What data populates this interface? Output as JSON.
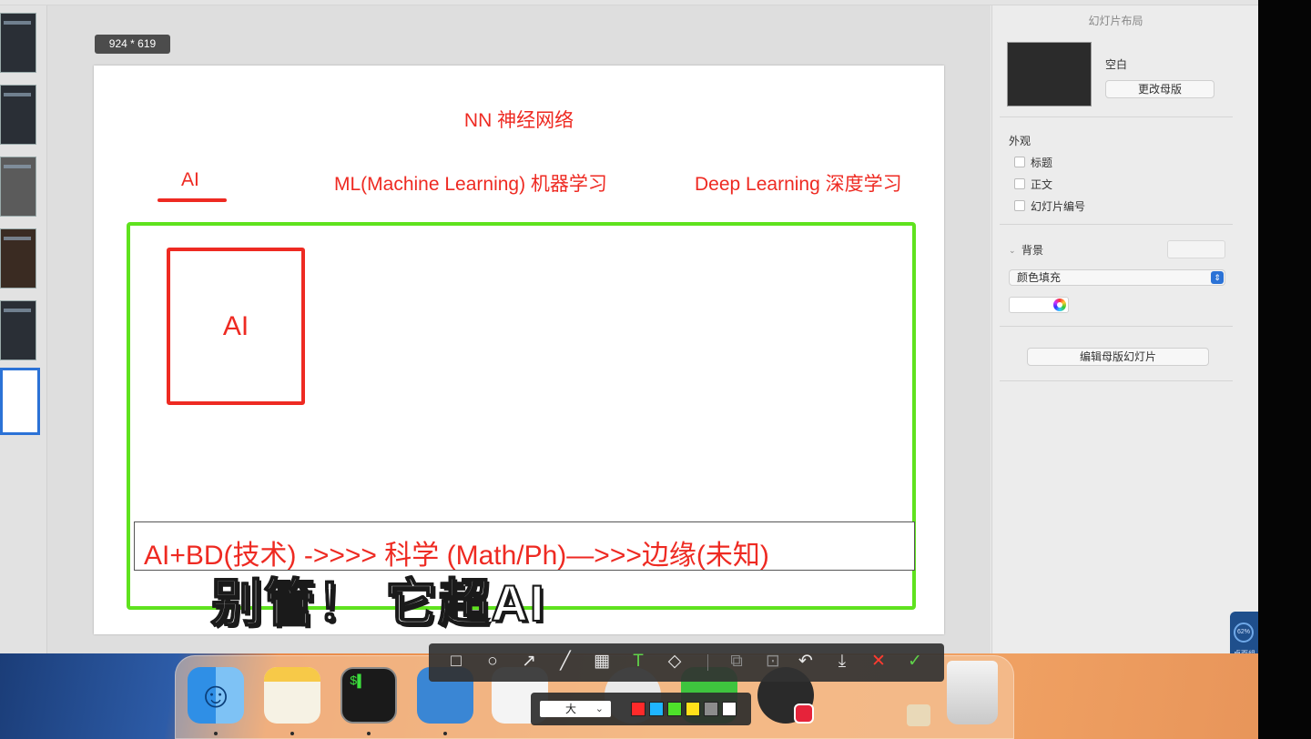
{
  "canvas": {
    "size_badge": "924 * 619"
  },
  "slide": {
    "title": "NN 神经网络",
    "label_ai": "AI",
    "label_ml": "ML(Machine Learning) 机器学习",
    "label_dl": "Deep Learning 深度学习",
    "box_label": "AI",
    "bottom_text": "AI+BD(技术) ->>>> 科学 (Math/Ph)—>>>边缘(未知)"
  },
  "caption": "别管！ 它超AI",
  "inspector": {
    "header": "幻灯片布局",
    "master_name": "空白",
    "change_master_button": "更改母版",
    "appearance_label": "外观",
    "checkboxes": [
      "标题",
      "正文",
      "幻灯片编号"
    ],
    "background_label": "背景",
    "fill_select": "颜色填充",
    "edit_master_button": "编辑母版幻灯片"
  },
  "widget": {
    "percent": "62%",
    "label": "桌面组件"
  },
  "screenshot_toolbar": {
    "tools": [
      "rectangle-icon",
      "ellipse-icon",
      "arrow-icon",
      "pen-icon",
      "mosaic-icon",
      "text-icon",
      "tag-icon",
      "pin-icon",
      "ocr-icon",
      "undo-icon",
      "download-icon",
      "cancel-icon",
      "confirm-icon"
    ],
    "size_select": "大",
    "colors": [
      "#ff2a2a",
      "#1fb5ff",
      "#4ee12a",
      "#ffe11a",
      "#8c8c8c",
      "#ffffff"
    ]
  },
  "colors": {
    "slide_red": "#ee2a22",
    "frame_green": "#5fe21e",
    "selection_blue": "#2b72d6"
  }
}
